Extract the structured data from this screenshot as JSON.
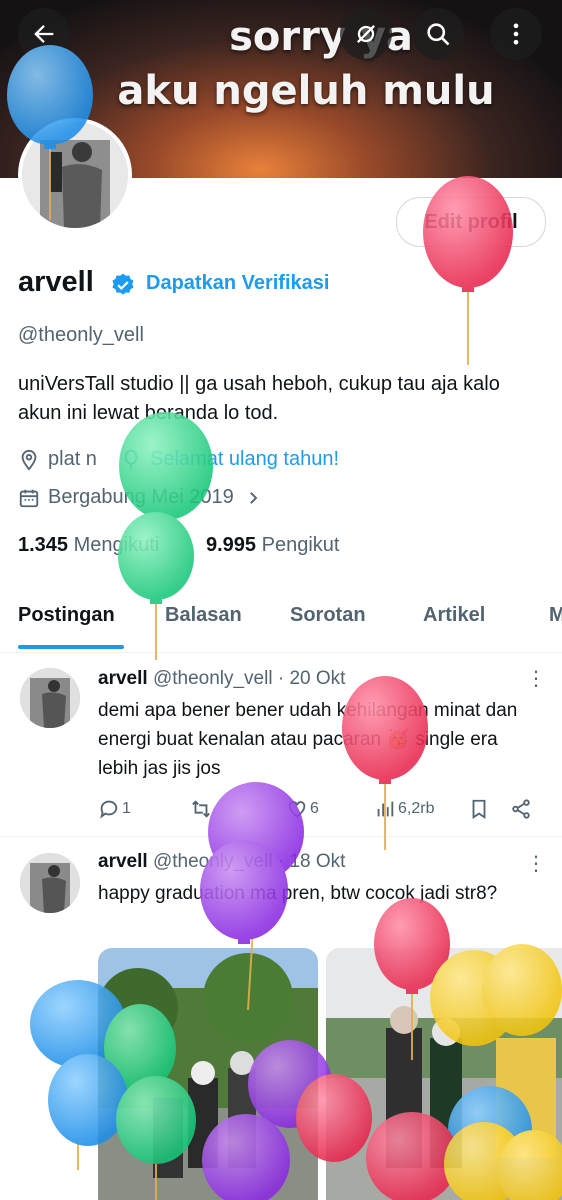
{
  "banner": {
    "line1": "sorry ya",
    "line2": "aku ngeluh mulu"
  },
  "profile": {
    "name": "arvell",
    "get_verified": "Dapatkan Verifikasi",
    "handle": "@theonly_vell",
    "bio": "uniVersTall studio || ga usah heboh, cukup tau aja kalo akun ini lewat beranda lo tod.",
    "location": "plat n",
    "birthday": "Selamat ulang tahun!",
    "joined": "Bergabung Mei 2019",
    "edit_label": "Edit profil",
    "following_count": "1.345",
    "following_label": "Mengikuti",
    "followers_count": "9.995",
    "followers_label": "Pengikut"
  },
  "tabs": [
    "Postingan",
    "Balasan",
    "Sorotan",
    "Artikel",
    "M"
  ],
  "posts": [
    {
      "name": "arvell",
      "handle": "@theonly_vell",
      "time": "· 20 Okt",
      "text": "demi apa bener bener udah kehilangan minat dan energi buat kenalan atau pacaran 🥳 single era lebih jas jis jos",
      "replies": "1",
      "likes": "6",
      "views": "6,2rb"
    },
    {
      "name": "arvell",
      "handle": "@theonly_vell",
      "time": "· 18 Okt",
      "text": "happy graduation ma pren, btw cocok jadi str8?"
    }
  ],
  "icons": {
    "back": "arrow-left-icon",
    "mute": "eye-slash-icon",
    "search": "search-icon",
    "more": "more-vertical-icon"
  },
  "colors": {
    "accent": "#1d9bf0",
    "text": "#0f1419",
    "muted": "#536471"
  }
}
